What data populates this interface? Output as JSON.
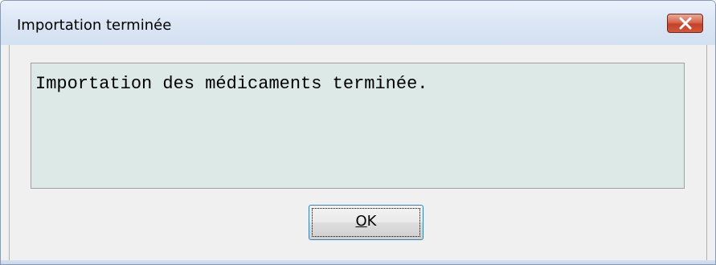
{
  "window": {
    "title": "Importation terminée",
    "close_icon": "close-x-icon"
  },
  "message": {
    "text": "Importation des médicaments terminée."
  },
  "buttons": {
    "ok_mnemonic": "O",
    "ok_rest": "K"
  },
  "colors": {
    "titlebar": "#dce7f5",
    "close_button": "#c24129",
    "message_background": "#dde9e6",
    "dialog_background": "#f0f0f0",
    "button_focus_border": "#3c7fb1"
  }
}
